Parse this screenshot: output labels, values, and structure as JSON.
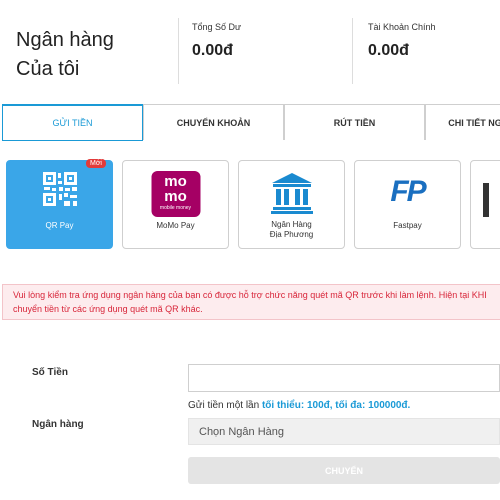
{
  "header": {
    "title_line1": "Ngân hàng",
    "title_line2": "Của tôi",
    "total_balance_label": "Tổng Số Dư",
    "total_balance_value": "0.00đ",
    "main_account_label": "Tài Khoản Chính",
    "main_account_value": "0.00đ"
  },
  "tabs": [
    {
      "label": "GỬI TIỀN",
      "active": true
    },
    {
      "label": "CHUYỂN KHOẢN",
      "active": false
    },
    {
      "label": "RÚT TIỀN",
      "active": false
    },
    {
      "label": "CHI TIẾT NG",
      "active": false
    }
  ],
  "methods": [
    {
      "label": "QR Pay",
      "badge": "Mới",
      "icon": "qr-code-icon",
      "active": true
    },
    {
      "label": "MoMo Pay",
      "icon": "momo-logo-icon",
      "logo_text_1": "mo",
      "logo_text_2": "mo",
      "logo_text_3": "mobile money"
    },
    {
      "label_line1": "Ngân Hàng",
      "label_line2": "Địa Phương",
      "icon": "bank-icon"
    },
    {
      "label": "Fastpay",
      "icon": "fastpay-logo-icon",
      "logo_text": "FP"
    }
  ],
  "alert": {
    "line1": "Vui lòng kiểm tra ứng dụng ngân hàng của bạn có được hỗ trợ chức năng quét mã QR trước khi làm lệnh. Hiện tại KHI",
    "line2": "chuyển tiền từ các ứng dụng quét mã QR khác."
  },
  "form": {
    "amount_label": "Số Tiền",
    "amount_value": "",
    "hint_prefix": "Gửi tiền một lần",
    "hint_limits": "tối thiểu: 100đ, tối đa: 100000đ.",
    "bank_label": "Ngân hàng",
    "bank_select": "Chọn Ngân Hàng",
    "submit_label": "CHUYỂN"
  },
  "colors": {
    "accent": "#1a9ad6",
    "qr_card": "#3aa6e8",
    "momo": "#a50064",
    "bank": "#1a8ad0",
    "alert_text": "#d8263a"
  }
}
